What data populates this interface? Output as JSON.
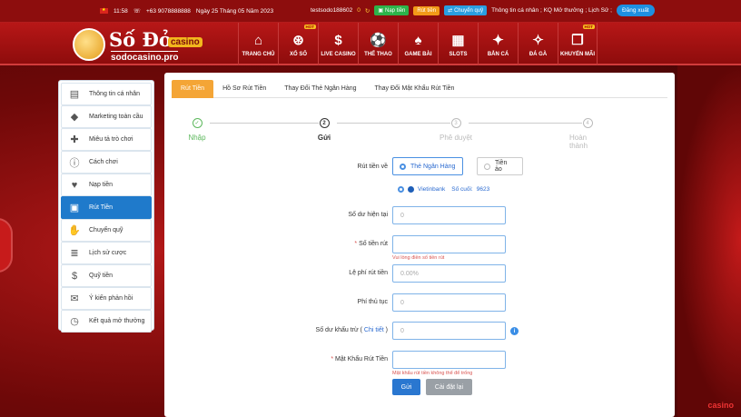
{
  "topbar": {
    "time": "11:58",
    "phone": "+63 9078888888",
    "date": "Ngày 25 Tháng 05 Năm 2023",
    "username": "testsodo188602",
    "balance": "0",
    "deposit_label": "Nạp tiền",
    "withdraw_label": "Rút tiền",
    "transfer_label": "Chuyển quỹ",
    "account_links": "Thông tin cá nhân ; KQ Mở thưởng ; Lịch Sử ;",
    "logout_label": "Đăng xuất"
  },
  "logo": {
    "title": "Số Đỏ",
    "casino": "casino",
    "subtitle": "sodocasino.pro"
  },
  "nav": [
    {
      "label": "TRANG CHỦ",
      "icon": "home-icon",
      "glyph": "⌂",
      "hot": ""
    },
    {
      "label": "XỔ SỐ",
      "icon": "lottery-ball-icon",
      "glyph": "⊛",
      "hot": "HOT"
    },
    {
      "label": "LIVE CASINO",
      "icon": "casino-chip-icon",
      "glyph": "$",
      "hot": ""
    },
    {
      "label": "THỂ THAO",
      "icon": "sports-ball-icon",
      "glyph": "⚽",
      "hot": ""
    },
    {
      "label": "GAME BÀI",
      "icon": "cards-icon",
      "glyph": "♠",
      "hot": ""
    },
    {
      "label": "SLOTS",
      "icon": "slot-machine-icon",
      "glyph": "▦",
      "hot": ""
    },
    {
      "label": "BẮN CÁ",
      "icon": "fish-icon",
      "glyph": "✦",
      "hot": ""
    },
    {
      "label": "ĐÁ GÀ",
      "icon": "rooster-icon",
      "glyph": "✧",
      "hot": ""
    },
    {
      "label": "KHUYẾN MÃI",
      "icon": "gift-icon",
      "glyph": "❒",
      "hot": "HOT"
    }
  ],
  "sidebar": {
    "items": [
      {
        "label": "Thông tin cá nhân",
        "icon": "id-card-icon",
        "glyph": "▤",
        "active": false
      },
      {
        "label": "Marketing toàn cầu",
        "icon": "diamond-icon",
        "glyph": "◆",
        "active": false
      },
      {
        "label": "Miêu tả trò chơi",
        "icon": "gamepad-icon",
        "glyph": "✚",
        "active": false
      },
      {
        "label": "Cách chơi",
        "icon": "info-circle-icon",
        "glyph": "ⓘ",
        "active": false
      },
      {
        "label": "Nạp tiền",
        "icon": "piggy-bank-icon",
        "glyph": "♥",
        "active": false
      },
      {
        "label": "Rút Tiền",
        "icon": "withdraw-icon",
        "glyph": "▣",
        "active": true
      },
      {
        "label": "Chuyển quỹ",
        "icon": "transfer-hand-icon",
        "glyph": "✋",
        "active": false
      },
      {
        "label": "Lịch sử cược",
        "icon": "history-list-icon",
        "glyph": "≣",
        "active": false
      },
      {
        "label": "Quỹ tiền",
        "icon": "money-stack-icon",
        "glyph": "$",
        "active": false
      },
      {
        "label": "Ý kiến phản hồi",
        "icon": "chat-bubble-icon",
        "glyph": "✉",
        "active": false
      },
      {
        "label": "Kết quả mở thưởng",
        "icon": "clock-history-icon",
        "glyph": "◷",
        "active": false
      }
    ]
  },
  "tabs": [
    {
      "label": "Rút Tiền",
      "active": true
    },
    {
      "label": "Hồ Sơ Rút Tiền",
      "active": false
    },
    {
      "label": "Thay Đổi Thẻ Ngân Hàng",
      "active": false
    },
    {
      "label": "Thay Đổi Mật Khẩu Rút Tiền",
      "active": false
    }
  ],
  "steps": [
    {
      "num": "✓",
      "label": "Nhập",
      "state": "done"
    },
    {
      "num": "2",
      "label": "Gửi",
      "state": "current"
    },
    {
      "num": "3",
      "label": "Phê duyệt",
      "state": "todo"
    },
    {
      "num": "4",
      "label": "Hoàn thành",
      "state": "todo"
    }
  ],
  "form": {
    "withdraw_to_label": "Rút tiền về",
    "option_bank": "Thẻ Ngân Hàng",
    "option_virtual": "Tiền ảo",
    "bank_name": "Vietinbank",
    "last_digits_label": "Số cuối:",
    "last_digits": "9623",
    "current_balance_label": "Số dư hiện tại",
    "current_balance_value": "0",
    "amount_label": "Số tiền rút",
    "amount_required": "*",
    "amount_value": "",
    "amount_error": "Vui lòng điền số tiền rút",
    "fee_label": "Lệ phí rút tiền",
    "fee_placeholder": "0.00%",
    "procedure_fee_label": "Phí thủ tục",
    "procedure_fee_value": "0",
    "deducted_balance_label": "Số dư khấu trừ (",
    "deducted_detail_link": "Chi tiết",
    "deducted_balance_label_end": ")",
    "deducted_balance_value": "0",
    "password_label": "Mật Khẩu Rút Tiền",
    "password_required": "*",
    "password_error": "Mật khẩu rút tiền không thể để trống",
    "submit_label": "Gửi",
    "reset_label": "Cài đặt lại"
  },
  "corner_text": "casino"
}
